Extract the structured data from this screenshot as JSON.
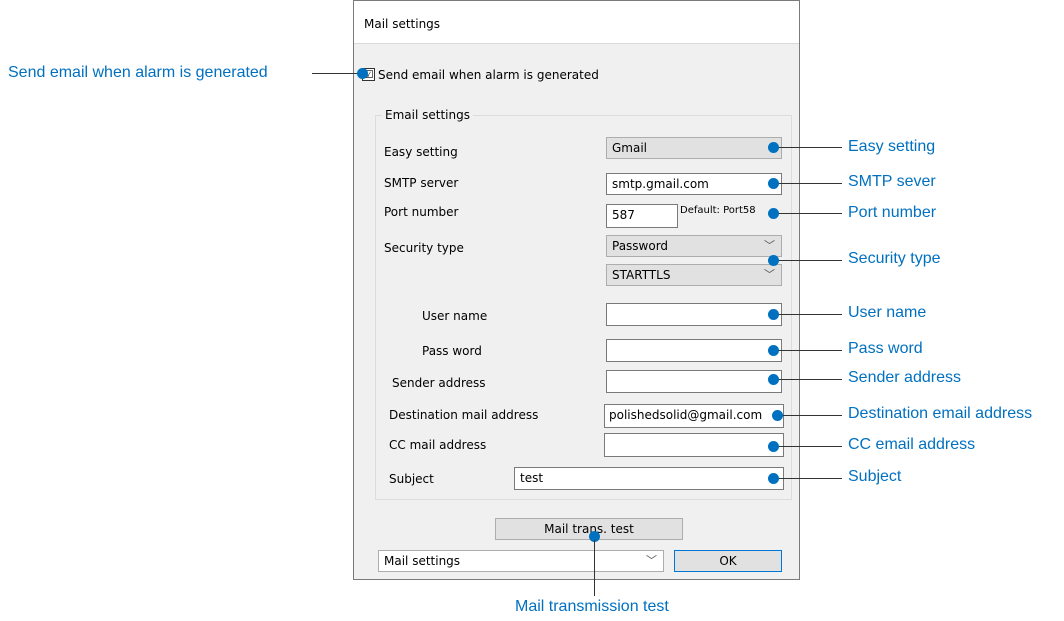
{
  "dialog": {
    "title": "Mail settings",
    "send_email_checkbox": {
      "label": "Send email when alarm is generated",
      "checked": true,
      "mark": "☑"
    },
    "email_settings": {
      "group_title": "Email settings",
      "easy_setting": {
        "label": "Easy setting",
        "value": "Gmail"
      },
      "smtp_server": {
        "label": "SMTP server",
        "value": "smtp.gmail.com"
      },
      "port_number": {
        "label": "Port number",
        "value": "587",
        "hint": "Default: Port58"
      },
      "security_type": {
        "label": "Security type",
        "value1": "Password",
        "value2": "STARTTLS"
      },
      "user_name": {
        "label": "User name",
        "value": ""
      },
      "pass_word": {
        "label": "Pass word",
        "value": ""
      },
      "sender_address": {
        "label": "Sender address",
        "value": ""
      },
      "destination_address": {
        "label": "Destination mail address",
        "value": "polishedsolid@gmail.com"
      },
      "cc_address": {
        "label": "CC mail address",
        "value": ""
      },
      "subject": {
        "label": "Subject",
        "value": "test"
      }
    },
    "mail_test_button": "Mail trans. test",
    "mode_select": "Mail settings",
    "ok_button": "OK"
  },
  "annotations": {
    "send_email": "Send email when alarm is generated",
    "easy_setting": "Easy setting",
    "smtp_server": "SMTP sever",
    "port_number": "Port number",
    "security_type": "Security type",
    "user_name": "User name",
    "pass_word": "Pass word",
    "sender_address": "Sender address",
    "destination_address": "Destination email address",
    "cc_address": "CC email address",
    "subject": "Subject",
    "mail_test": "Mail transmission test"
  },
  "colors": {
    "annotation": "#0070c0",
    "dialog_bg": "#f0f0f0"
  },
  "icons": {
    "chevron": "chevron-down-icon",
    "checkbox": "check-icon"
  }
}
